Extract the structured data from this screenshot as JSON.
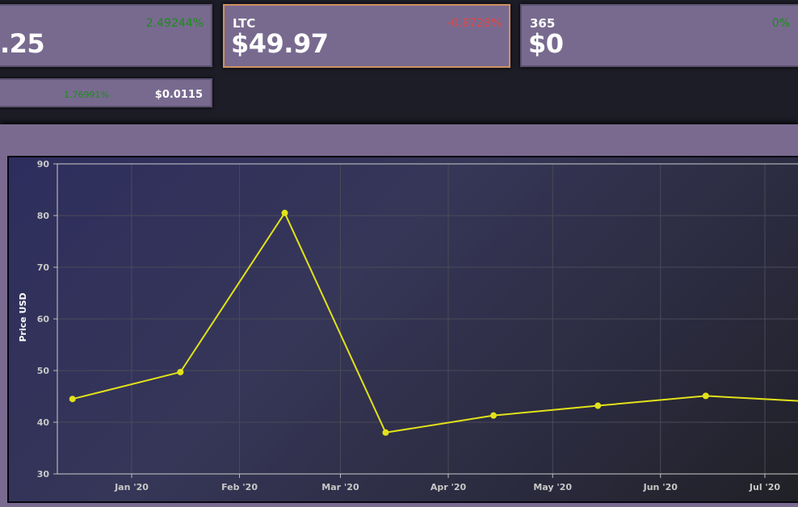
{
  "tickers": [
    {
      "symbol": "",
      "price": ".25",
      "change": "2.49244%",
      "direction": "up",
      "selected": false
    },
    {
      "symbol": "LTC",
      "price": "$49.97",
      "change": "-0.8728%",
      "direction": "down",
      "selected": true
    },
    {
      "symbol": "365",
      "price": "$0",
      "change": "0%",
      "direction": "up",
      "selected": false
    }
  ],
  "mini_ticker": {
    "change": "1.76991%",
    "price": "$0.0115"
  },
  "colors": {
    "card_bg": "#786a8f",
    "positive": "#1c8c1c",
    "negative": "#e04848",
    "line": "#e2e21a",
    "selected_border": "#d09060"
  },
  "chart_data": {
    "type": "line",
    "ylabel": "Price USD",
    "xlabel": "",
    "ylim": [
      30,
      90
    ],
    "y_ticks": [
      30,
      40,
      50,
      60,
      70,
      80,
      90
    ],
    "x_ticks": [
      "Jan '20",
      "Feb '20",
      "Mar '20",
      "Apr '20",
      "May '20",
      "Jun '20",
      "Jul '20"
    ],
    "x_tick_days": [
      0,
      31,
      60,
      91,
      121,
      152,
      182
    ],
    "grid": true,
    "series": [
      {
        "x": [
          "2019-12-15",
          "2020-01-15",
          "2020-02-14",
          "2020-03-15",
          "2020-04-15",
          "2020-05-15",
          "2020-06-15",
          "2020-07-15"
        ],
        "x_days": [
          -17,
          14,
          44,
          73,
          104,
          134,
          165,
          195
        ],
        "values": [
          44.5,
          49.7,
          80.5,
          38.0,
          41.3,
          43.2,
          45.1,
          44.0
        ]
      }
    ]
  }
}
